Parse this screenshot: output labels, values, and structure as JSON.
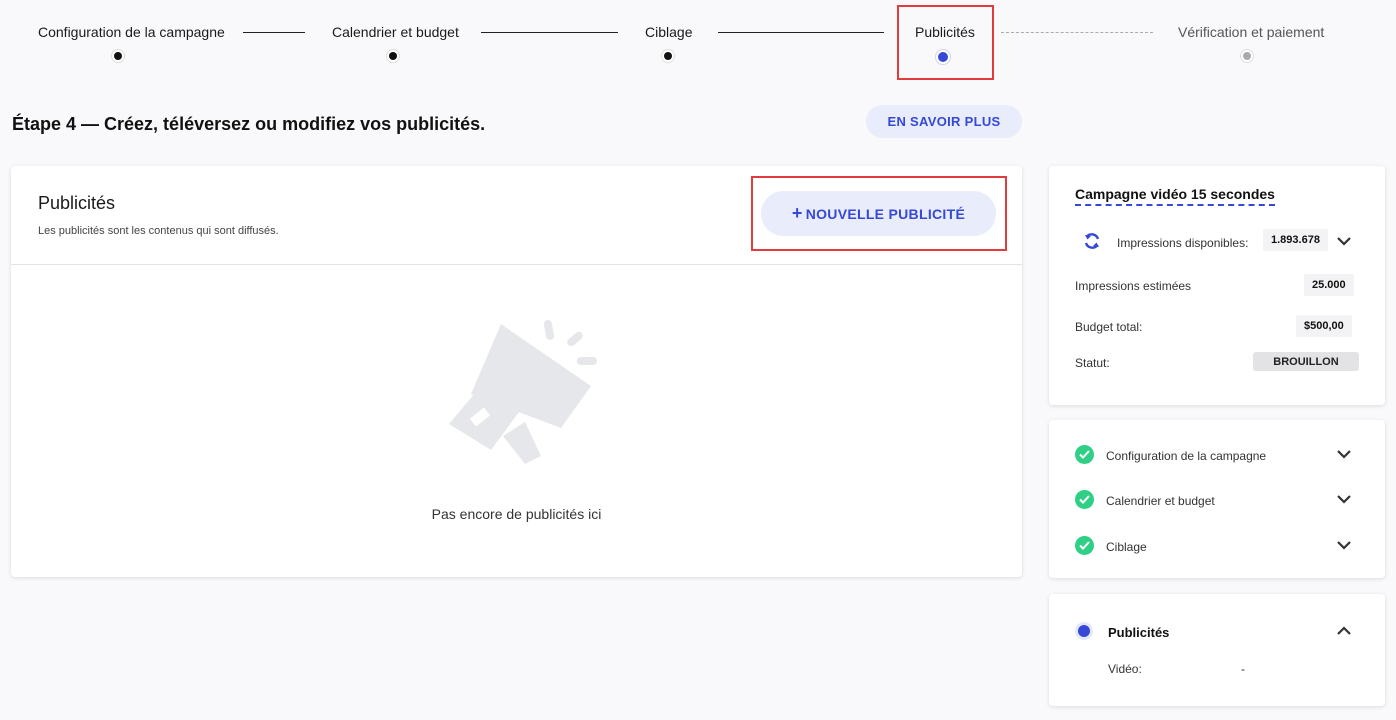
{
  "stepper": {
    "steps": [
      {
        "label": "Configuration de la campagne",
        "state": "done"
      },
      {
        "label": "Calendrier et budget",
        "state": "done"
      },
      {
        "label": "Ciblage",
        "state": "done"
      },
      {
        "label": "Publicités",
        "state": "current"
      },
      {
        "label": "Vérification et paiement",
        "state": "pending"
      }
    ]
  },
  "page": {
    "heading": "Étape 4 — Créez, téléversez ou modifiez vos publicités.",
    "learn_more": "EN SAVOIR PLUS"
  },
  "ads_panel": {
    "title": "Publicités",
    "subtitle": "Les publicités sont les contenus qui sont diffusés.",
    "new_ad_plus": "+",
    "new_ad_label": "NOUVELLE PUBLICITÉ",
    "empty_icon": "megaphone-icon",
    "empty_text": "Pas encore de publicités ici"
  },
  "summary": {
    "campaign_name": "Campagne vidéo 15 secondes",
    "refresh_icon": "refresh-icon",
    "available_label": "Impressions disponibles:",
    "available_value": "1.893.678",
    "estimated_label": "Impressions estimées",
    "estimated_value": "25.000",
    "budget_label": "Budget total:",
    "budget_value": "$500,00",
    "status_label": "Statut:",
    "status_value": "BROUILLON"
  },
  "completed_steps": [
    {
      "label": "Configuration de la campagne"
    },
    {
      "label": "Calendrier et budget"
    },
    {
      "label": "Ciblage"
    }
  ],
  "current_section": {
    "title": "Publicités",
    "video_label": "Vidéo:",
    "video_value": "-"
  },
  "colors": {
    "accent": "#3549d6",
    "accent_light": "#e9ecfa",
    "success": "#2fcf86",
    "highlight": "#e23b3b"
  }
}
